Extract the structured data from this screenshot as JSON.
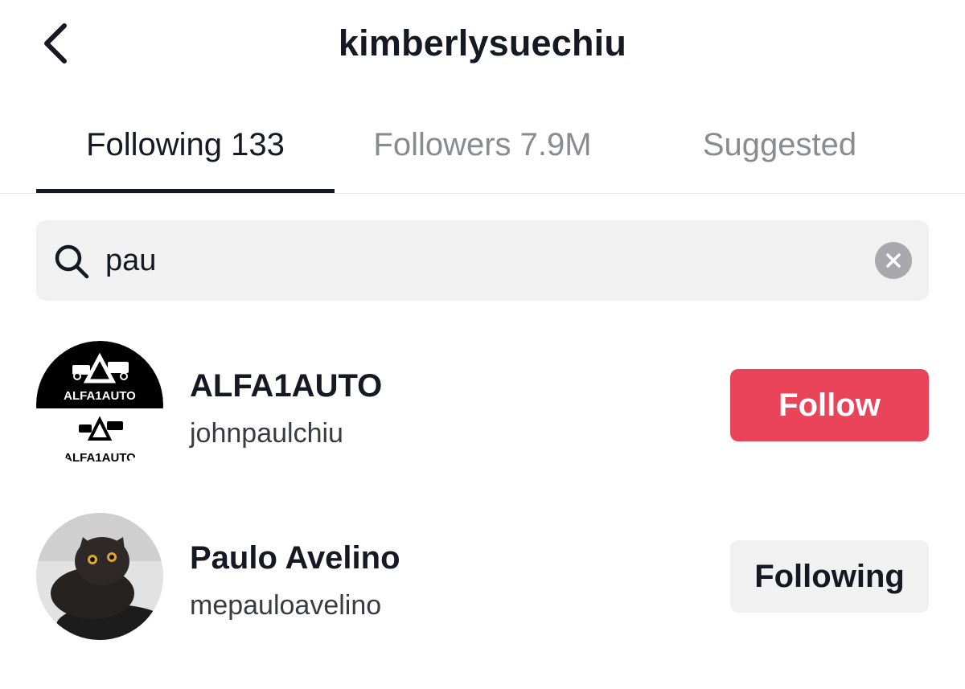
{
  "header": {
    "title": "kimberlysuechiu",
    "back_icon": "chevron-left-icon"
  },
  "tabs": [
    {
      "label": "Following 133",
      "active": true
    },
    {
      "label": "Followers 7.9M",
      "active": false
    },
    {
      "label": "Suggested",
      "active": false
    }
  ],
  "search": {
    "icon": "search-icon",
    "value": "pau",
    "clear_icon": "clear-icon"
  },
  "results": [
    {
      "display_name": "ALFA1AUTO",
      "username": "johnpaulchiu",
      "avatar_text": "ALFA1AUTO",
      "button_label": "Follow",
      "button_state": "follow"
    },
    {
      "display_name": "Paulo Avelino",
      "username": "mepauloavelino",
      "avatar": "cat-photo",
      "button_label": "Following",
      "button_state": "following"
    }
  ],
  "colors": {
    "follow_button": "#ea445a",
    "following_button": "#f1f1f2",
    "text_primary": "#161823",
    "text_secondary": "#8a8b91"
  }
}
